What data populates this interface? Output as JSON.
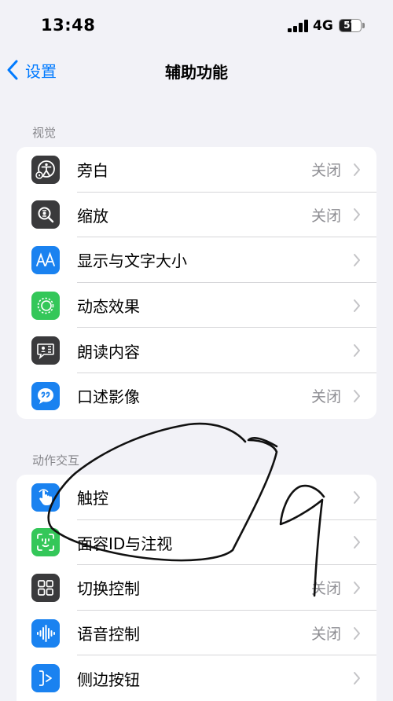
{
  "status": {
    "time": "13:48",
    "network": "4G",
    "battery": "57",
    "battery_level": 0.57
  },
  "nav": {
    "back_label": "设置",
    "title": "辅助功能"
  },
  "sections": [
    {
      "header": "视觉",
      "items": [
        {
          "label": "旁白",
          "value": "关闭",
          "icon": "voiceover-icon",
          "color": "#3a3a3c"
        },
        {
          "label": "缩放",
          "value": "关闭",
          "icon": "zoom-icon",
          "color": "#3a3a3c"
        },
        {
          "label": "显示与文字大小",
          "value": "",
          "icon": "text-size-icon",
          "color": "#1a82f0"
        },
        {
          "label": "动态效果",
          "value": "",
          "icon": "motion-icon",
          "color": "#34c759"
        },
        {
          "label": "朗读内容",
          "value": "",
          "icon": "spoken-content-icon",
          "color": "#3a3a3c"
        },
        {
          "label": "口述影像",
          "value": "关闭",
          "icon": "audio-description-icon",
          "color": "#1a82f0"
        }
      ]
    },
    {
      "header": "动作交互",
      "items": [
        {
          "label": "触控",
          "value": "",
          "icon": "touch-icon",
          "color": "#1a82f0"
        },
        {
          "label": "面容ID与注视",
          "value": "",
          "icon": "face-id-icon",
          "color": "#34c759"
        },
        {
          "label": "切换控制",
          "value": "关闭",
          "icon": "switch-control-icon",
          "color": "#3a3a3c"
        },
        {
          "label": "语音控制",
          "value": "关闭",
          "icon": "voice-control-icon",
          "color": "#1a82f0"
        },
        {
          "label": "侧边按钮",
          "value": "",
          "icon": "side-button-icon",
          "color": "#1a82f0"
        }
      ]
    }
  ]
}
